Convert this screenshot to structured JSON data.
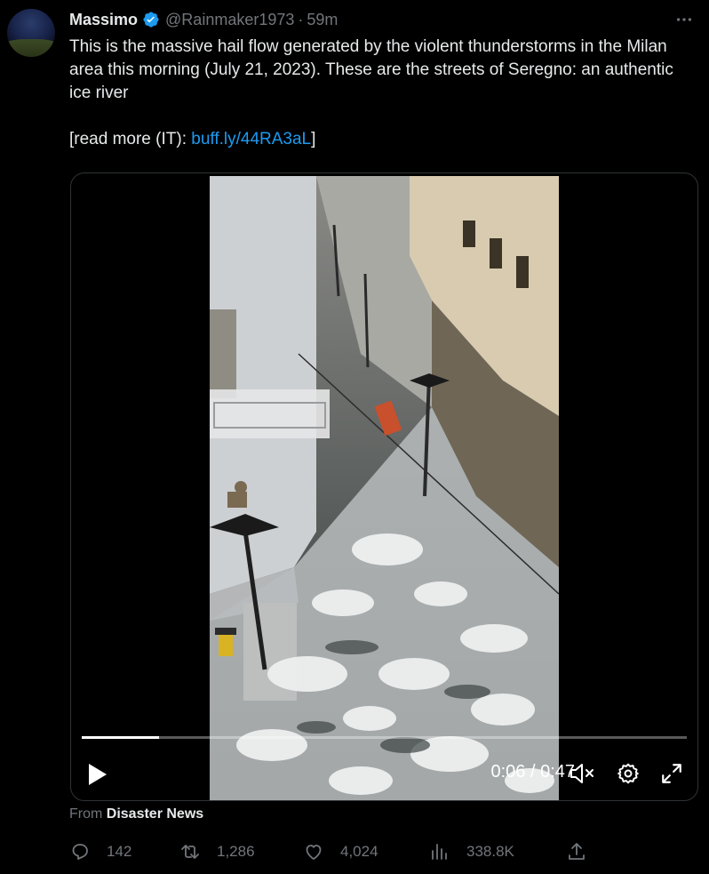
{
  "author": {
    "name": "Massimo",
    "handle": "@Rainmaker1973",
    "separator": "·",
    "time": "59m",
    "verified_color": "#1d9bf0"
  },
  "more_icon": "more-horizontal-icon",
  "tweet": {
    "text": "This is the massive hail flow generated by the violent thunderstorms in the Milan area this morning (July 21, 2023). These are the streets of Seregno: an authentic ice river\n\n[read more (IT): ",
    "link": "buff.ly/44RA3aL",
    "after_link": "]"
  },
  "video": {
    "progress": 0.128,
    "timecode": "0:06 / 0:47",
    "icons": [
      "play-icon",
      "mute-icon",
      "settings-icon",
      "fullscreen-icon"
    ]
  },
  "source": {
    "prefix": "From ",
    "name": "Disaster News"
  },
  "actions": {
    "replies": "142",
    "reposts": "1,286",
    "likes": "4,024",
    "views": "338.8K"
  },
  "colors": {
    "accent": "#1d9bf0",
    "muted": "#71767b",
    "text": "#e7e9ea",
    "background": "#000000"
  }
}
